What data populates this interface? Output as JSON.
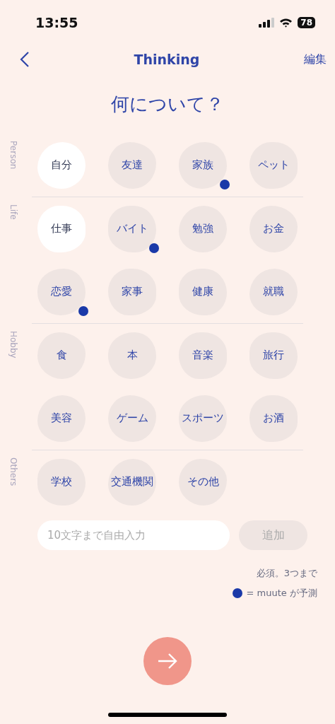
{
  "status_bar": {
    "time": "13:55",
    "battery": "78"
  },
  "nav": {
    "title": "Thinking",
    "action": "編集"
  },
  "heading": "何について？",
  "sections": [
    {
      "label": "Person",
      "chips": [
        {
          "label": "自分",
          "selected": true,
          "predicted": false
        },
        {
          "label": "友達",
          "selected": false,
          "predicted": false
        },
        {
          "label": "家族",
          "selected": false,
          "predicted": true
        },
        {
          "label": "ペット",
          "selected": false,
          "predicted": false
        }
      ]
    },
    {
      "label": "Life",
      "chips": [
        {
          "label": "仕事",
          "selected": true,
          "predicted": false
        },
        {
          "label": "バイト",
          "selected": false,
          "predicted": true
        },
        {
          "label": "勉強",
          "selected": false,
          "predicted": false
        },
        {
          "label": "お金",
          "selected": false,
          "predicted": false
        },
        {
          "label": "恋愛",
          "selected": false,
          "predicted": true
        },
        {
          "label": "家事",
          "selected": false,
          "predicted": false
        },
        {
          "label": "健康",
          "selected": false,
          "predicted": false
        },
        {
          "label": "就職",
          "selected": false,
          "predicted": false
        }
      ]
    },
    {
      "label": "Hobby",
      "chips": [
        {
          "label": "食",
          "selected": false,
          "predicted": false
        },
        {
          "label": "本",
          "selected": false,
          "predicted": false
        },
        {
          "label": "音楽",
          "selected": false,
          "predicted": false
        },
        {
          "label": "旅行",
          "selected": false,
          "predicted": false
        },
        {
          "label": "美容",
          "selected": false,
          "predicted": false
        },
        {
          "label": "ゲーム",
          "selected": false,
          "predicted": false
        },
        {
          "label": "スポーツ",
          "selected": false,
          "predicted": false
        },
        {
          "label": "お酒",
          "selected": false,
          "predicted": false
        }
      ]
    },
    {
      "label": "Others",
      "chips": [
        {
          "label": "学校",
          "selected": false,
          "predicted": false
        },
        {
          "label": "交通機関",
          "selected": false,
          "predicted": false
        },
        {
          "label": "その他",
          "selected": false,
          "predicted": false
        }
      ]
    }
  ],
  "input": {
    "placeholder": "10文字まで自由入力"
  },
  "add_button": {
    "label": "追加",
    "disabled": true
  },
  "note": "必須。3つまで",
  "legend": "= muute が予測"
}
